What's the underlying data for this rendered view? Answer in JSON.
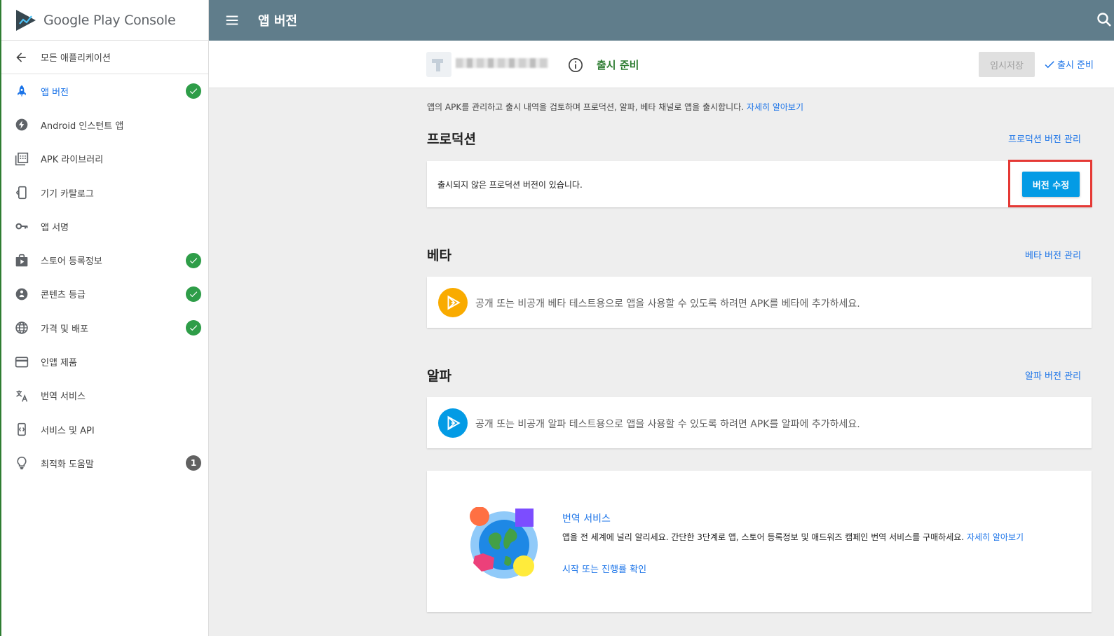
{
  "brand": {
    "name": "Google Play Console"
  },
  "topbar": {
    "title": "앱 버전",
    "menu_icon": "menu-icon",
    "search_icon": "search-icon"
  },
  "sidebar": {
    "back_label": "모든 애플리케이션",
    "items": [
      {
        "label": "앱 버전",
        "icon": "rocket-icon",
        "badge": "check",
        "active": true
      },
      {
        "label": "Android 인스턴트 앱",
        "icon": "bolt-icon",
        "badge": ""
      },
      {
        "label": "APK 라이브러리",
        "icon": "library-icon",
        "badge": ""
      },
      {
        "label": "기기 카탈로그",
        "icon": "device-icon",
        "badge": ""
      },
      {
        "label": "앱 서명",
        "icon": "key-icon",
        "badge": ""
      },
      {
        "label": "스토어 등록정보",
        "icon": "store-icon",
        "badge": "check"
      },
      {
        "label": "콘텐츠 등급",
        "icon": "rating-icon",
        "badge": "check"
      },
      {
        "label": "가격 및 배포",
        "icon": "globe-icon",
        "badge": "check"
      },
      {
        "label": "인앱 제품",
        "icon": "card-icon",
        "badge": ""
      },
      {
        "label": "번역 서비스",
        "icon": "translate-icon",
        "badge": ""
      },
      {
        "label": "서비스 및 API",
        "icon": "api-icon",
        "badge": ""
      },
      {
        "label": "최적화 도움말",
        "icon": "bulb-icon",
        "badge": "1"
      }
    ]
  },
  "app_header": {
    "status": "출시 준비",
    "draft_button": "임시저장",
    "publish_button": "출시 준비"
  },
  "main": {
    "description": "앱의 APK를 관리하고 출시 내역을 검토하며 프로덕션, 알파, 베타 채널로 앱을 출시합니다.",
    "learn_more": "자세히 알아보기",
    "production": {
      "title": "프로덕션",
      "manage_link": "프로덕션 버전 관리",
      "message": "출시되지 않은 프로덕션 버전이 있습니다.",
      "edit_button": "버전 수정"
    },
    "beta": {
      "title": "베타",
      "manage_link": "베타 버전 관리",
      "message": "공개 또는 비공개 베타 테스트용으로 앱을 사용할 수 있도록 하려면 APK를 베타에 추가하세요.",
      "color": "#f9ab00"
    },
    "alpha": {
      "title": "알파",
      "manage_link": "알파 버전 관리",
      "message": "공개 또는 비공개 알파 테스트용으로 앱을 사용할 수 있도록 하려면 APK를 알파에 추가하세요.",
      "color": "#039be5"
    },
    "translation": {
      "title": "번역 서비스",
      "description": "앱을 전 세계에 널리 알리세요. 간단한 3단계로 앱, 스토어 등록정보 및 애드워즈 캠페인 번역 서비스를 구매하세요.",
      "learn_more": "자세히 알아보기",
      "action_link": "시작 또는 진행률 확인"
    }
  },
  "colors": {
    "accent": "#1a73e8",
    "topbar": "#607d8b",
    "success": "#2e9d48",
    "highlight": "#e53935"
  }
}
